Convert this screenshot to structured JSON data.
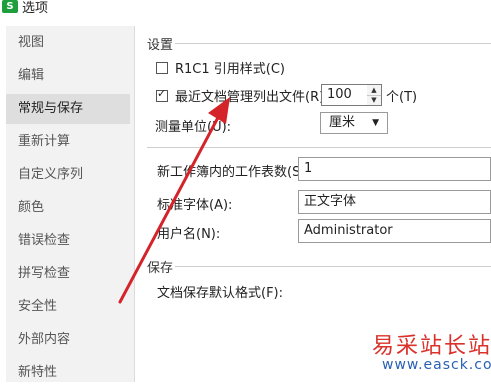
{
  "window": {
    "app_icon_letter": "S",
    "title": "选项"
  },
  "sidebar": {
    "items": [
      {
        "label": "视图",
        "active": false
      },
      {
        "label": "编辑",
        "active": false
      },
      {
        "label": "常规与保存",
        "active": true
      },
      {
        "label": "重新计算",
        "active": false
      },
      {
        "label": "自定义序列",
        "active": false
      },
      {
        "label": "颜色",
        "active": false
      },
      {
        "label": "错误检查",
        "active": false
      },
      {
        "label": "拼写检查",
        "active": false
      },
      {
        "label": "安全性",
        "active": false
      },
      {
        "label": "外部内容",
        "active": false
      },
      {
        "label": "新特性",
        "active": false
      }
    ]
  },
  "settings": {
    "section_title": "设置",
    "r1c1_label": "R1C1 引用样式(C)",
    "r1c1_checked": false,
    "recent_files_label": "最近文档管理列出文件(R):",
    "recent_files_checked": true,
    "recent_files_value": "100",
    "recent_files_unit": "个(T)",
    "measure_unit_label": "测量单位(U):",
    "measure_unit_value": "厘米",
    "sheets_label": "新工作簿内的工作表数(S):",
    "sheets_value": "1",
    "font_label": "标准字体(A):",
    "font_value": "正文字体",
    "username_label": "用户名(N):",
    "username_value": "Administrator"
  },
  "save": {
    "section_title": "保存",
    "default_format_label": "文档保存默认格式(F):"
  },
  "annotation": {
    "arrow_color": "#d4242a"
  },
  "watermark": {
    "site_name": "易采站长站",
    "site_url": "www.easck.com"
  },
  "colors": {
    "active_item_bg": "#dedede",
    "sidebar_bg": "#f2f2f2",
    "app_icon": "#1f9e3d"
  }
}
